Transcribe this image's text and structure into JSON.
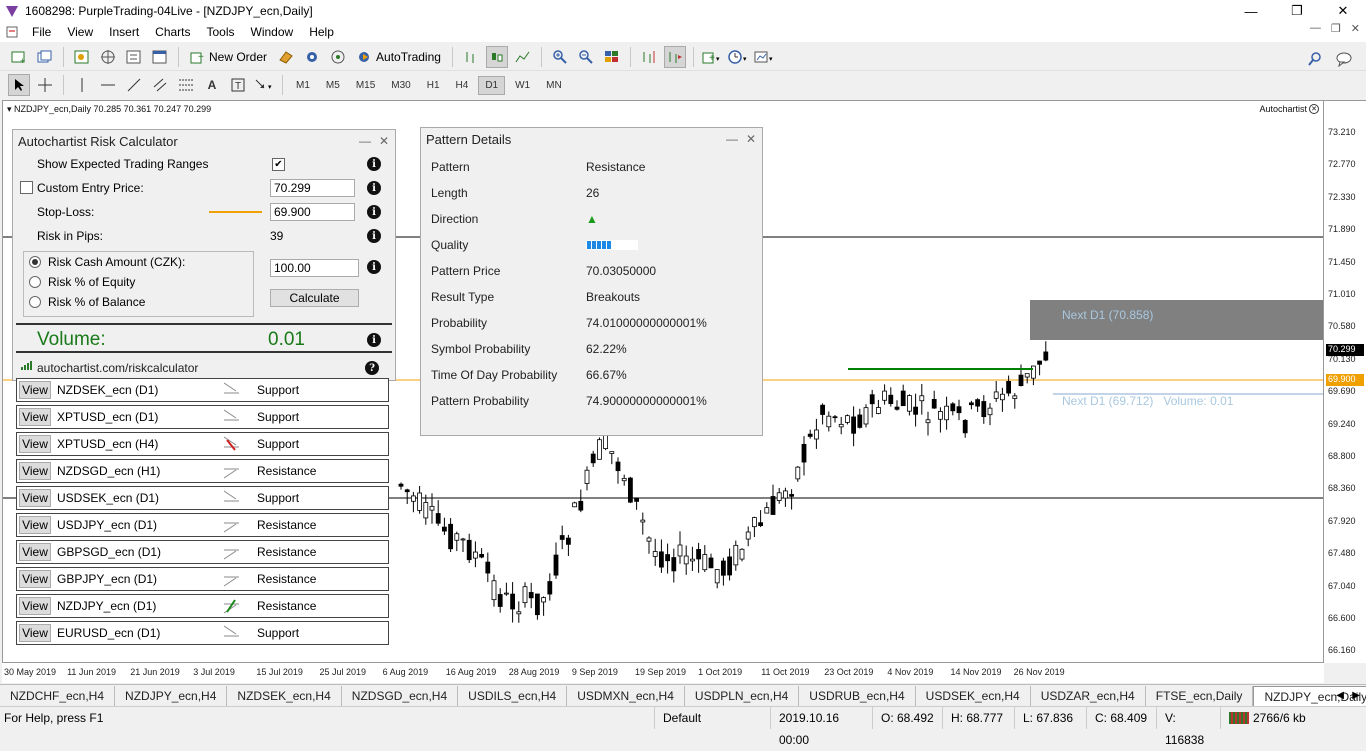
{
  "window": {
    "title": "1608298: PurpleTrading-04Live - [NZDJPY_ecn,Daily]",
    "btn_min": "—",
    "btn_max": "❐",
    "btn_close": "✕"
  },
  "menu": [
    "File",
    "View",
    "Insert",
    "Charts",
    "Tools",
    "Window",
    "Help"
  ],
  "toolbar": {
    "new_order": "New Order",
    "autotrading": "AutoTrading",
    "timeframes": [
      "M1",
      "M5",
      "M15",
      "M30",
      "H1",
      "H4",
      "D1",
      "W1",
      "MN"
    ],
    "active_timeframe": "D1"
  },
  "chart": {
    "header": "NZDJPY_ecn,Daily  70.285 70.361 70.247 70.299",
    "autochartist_label": "Autochartist",
    "next_up_label": "Next D1 (70.858)",
    "next_down_label": "Next D1 (69.712)   Volume: 0.01",
    "price_labels": [
      "73.210",
      "72.770",
      "72.330",
      "71.890",
      "71.450",
      "71.010",
      "70.580",
      "70.130",
      "69.690",
      "69.240",
      "68.800",
      "68.360",
      "67.920",
      "67.480",
      "67.040",
      "66.600",
      "66.160"
    ],
    "current_price": "70.299",
    "stoploss_price": "69.900",
    "time_labels": [
      "30 May 2019",
      "11 Jun 2019",
      "21 Jun 2019",
      "3 Jul 2019",
      "15 Jul 2019",
      "25 Jul 2019",
      "6 Aug 2019",
      "16 Aug 2019",
      "28 Aug 2019",
      "9 Sep 2019",
      "19 Sep 2019",
      "1 Oct 2019",
      "11 Oct 2019",
      "23 Oct 2019",
      "4 Nov 2019",
      "14 Nov 2019",
      "26 Nov 2019"
    ],
    "colors": {
      "stoploss": "#f0a000",
      "trendline": "#008000",
      "zone": "#808080",
      "info_text": "#a8c8e0"
    }
  },
  "risk_calc": {
    "title": "Autochartist Risk Calculator",
    "show_ranges_label": "Show Expected Trading Ranges",
    "show_ranges_checked": true,
    "custom_entry_label": "Custom Entry Price:",
    "custom_entry_value": "70.299",
    "stop_loss_label": "Stop-Loss:",
    "stop_loss_value": "69.900",
    "risk_pips_label": "Risk in Pips:",
    "risk_pips_value": "39",
    "radio_cash": "Risk Cash Amount (CZK):",
    "radio_equity": "Risk % of Equity",
    "radio_balance": "Risk % of Balance",
    "amount_value": "100.00",
    "calculate_label": "Calculate",
    "volume_label": "Volume:",
    "volume_value": "0.01",
    "link": "autochartist.com/riskcalculator"
  },
  "pattern_details": {
    "title": "Pattern Details",
    "rows": [
      {
        "k": "Pattern",
        "v": "Resistance"
      },
      {
        "k": "Length",
        "v": "26"
      },
      {
        "k": "Direction",
        "v": "▲"
      },
      {
        "k": "Quality",
        "v": ""
      },
      {
        "k": "Pattern Price",
        "v": "70.03050000"
      },
      {
        "k": "Result Type",
        "v": "Breakouts"
      },
      {
        "k": "Probability",
        "v": "74.01000000000001%"
      },
      {
        "k": "Symbol Probability",
        "v": "62.22%"
      },
      {
        "k": "Time Of Day Probability",
        "v": "66.67%"
      },
      {
        "k": "Pattern Probability",
        "v": "74.90000000000001%"
      }
    ],
    "quality_level": 5
  },
  "pattern_list": [
    {
      "view": "View",
      "symbol": "NZDSEK_ecn (D1)",
      "type": "Support",
      "dir": "down"
    },
    {
      "view": "View",
      "symbol": "XPTUSD_ecn (D1)",
      "type": "Support",
      "dir": "down"
    },
    {
      "view": "View",
      "symbol": "XPTUSD_ecn (H4)",
      "type": "Support",
      "dir": "break-down"
    },
    {
      "view": "View",
      "symbol": "NZDSGD_ecn (H1)",
      "type": "Resistance",
      "dir": "up"
    },
    {
      "view": "View",
      "symbol": "USDSEK_ecn (D1)",
      "type": "Support",
      "dir": "down"
    },
    {
      "view": "View",
      "symbol": "USDJPY_ecn (D1)",
      "type": "Resistance",
      "dir": "up"
    },
    {
      "view": "View",
      "symbol": "GBPSGD_ecn (D1)",
      "type": "Resistance",
      "dir": "up"
    },
    {
      "view": "View",
      "symbol": "GBPJPY_ecn (D1)",
      "type": "Resistance",
      "dir": "up"
    },
    {
      "view": "View",
      "symbol": "NZDJPY_ecn (D1)",
      "type": "Resistance",
      "dir": "break-up"
    },
    {
      "view": "View",
      "symbol": "EURUSD_ecn (D1)",
      "type": "Support",
      "dir": "down"
    }
  ],
  "tabs": [
    "NZDCHF_ecn,H4",
    "NZDJPY_ecn,H4",
    "NZDSEK_ecn,H4",
    "NZDSGD_ecn,H4",
    "USDILS_ecn,H4",
    "USDMXN_ecn,H4",
    "USDPLN_ecn,H4",
    "USDRUB_ecn,H4",
    "USDSEK_ecn,H4",
    "USDZAR_ecn,H4",
    "FTSE_ecn,Daily",
    "NZDJPY_ecn,Daily"
  ],
  "active_tab": "NZDJPY_ecn,Daily",
  "status": {
    "help": "For Help, press F1",
    "profile": "Default",
    "datetime": "2019.10.16 00:00",
    "open": "O: 68.492",
    "high": "H: 68.777",
    "low": "L: 67.836",
    "close": "C: 68.409",
    "volume": "V: 116838",
    "traffic": "2766/6 kb"
  }
}
